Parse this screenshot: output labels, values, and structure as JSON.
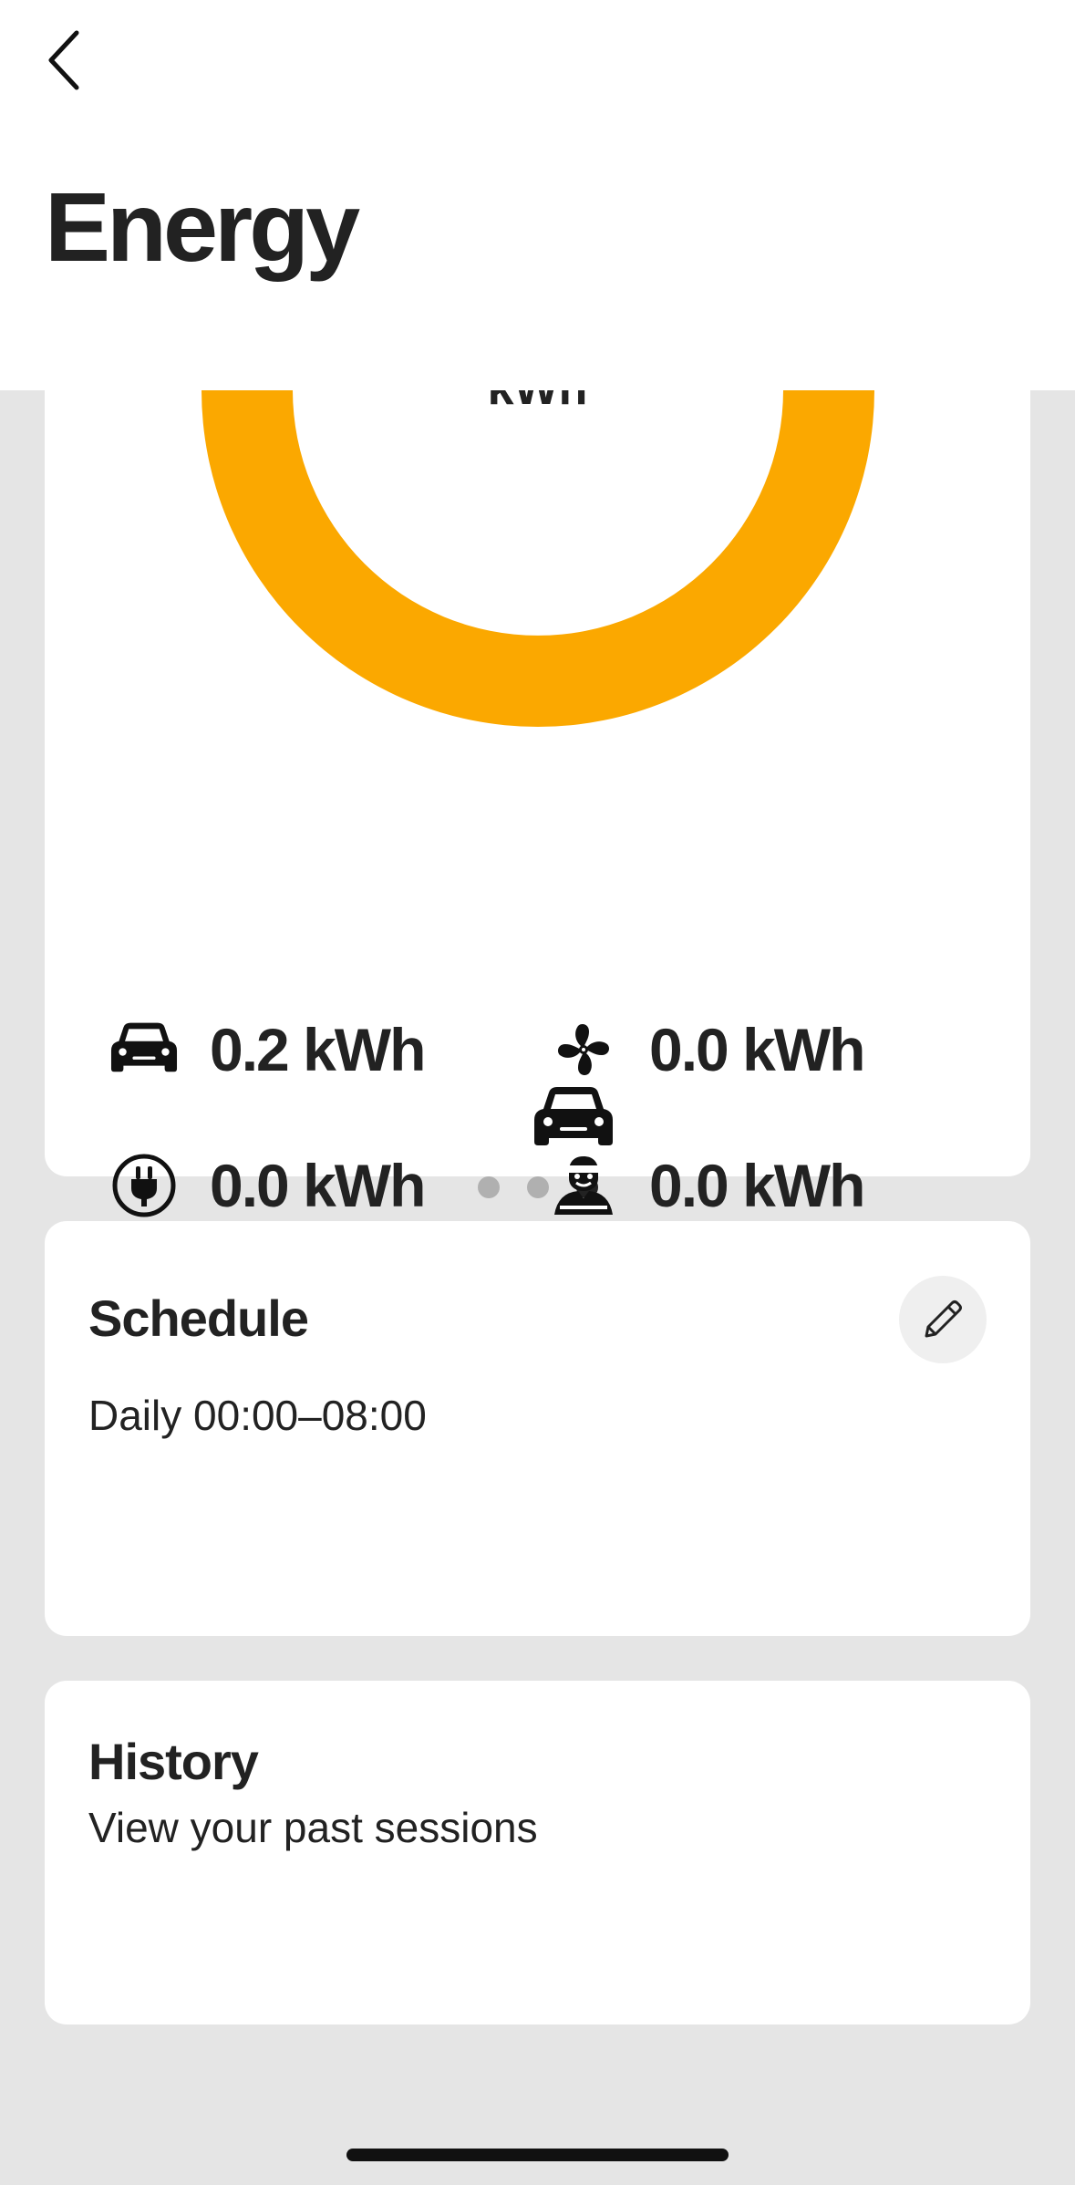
{
  "header": {
    "title": "Energy",
    "back_icon": "chevron-left-icon"
  },
  "energy_card": {
    "donut_unit": "kWh",
    "donut_color": "#FBA800",
    "carousel": {
      "page_count": 3,
      "active_index": 2
    },
    "stats": [
      {
        "icon": "car-icon",
        "value": "0.2 kWh"
      },
      {
        "icon": "fan-icon",
        "value": "0.0 kWh"
      },
      {
        "icon": "plug-icon",
        "value": "0.0 kWh"
      },
      {
        "icon": "person-icon",
        "value": "0.0 kWh"
      }
    ]
  },
  "schedule": {
    "title": "Schedule",
    "value": "Daily 00:00–08:00",
    "edit_icon": "pencil-icon"
  },
  "history": {
    "title": "History",
    "subtitle": "View your past sessions"
  }
}
